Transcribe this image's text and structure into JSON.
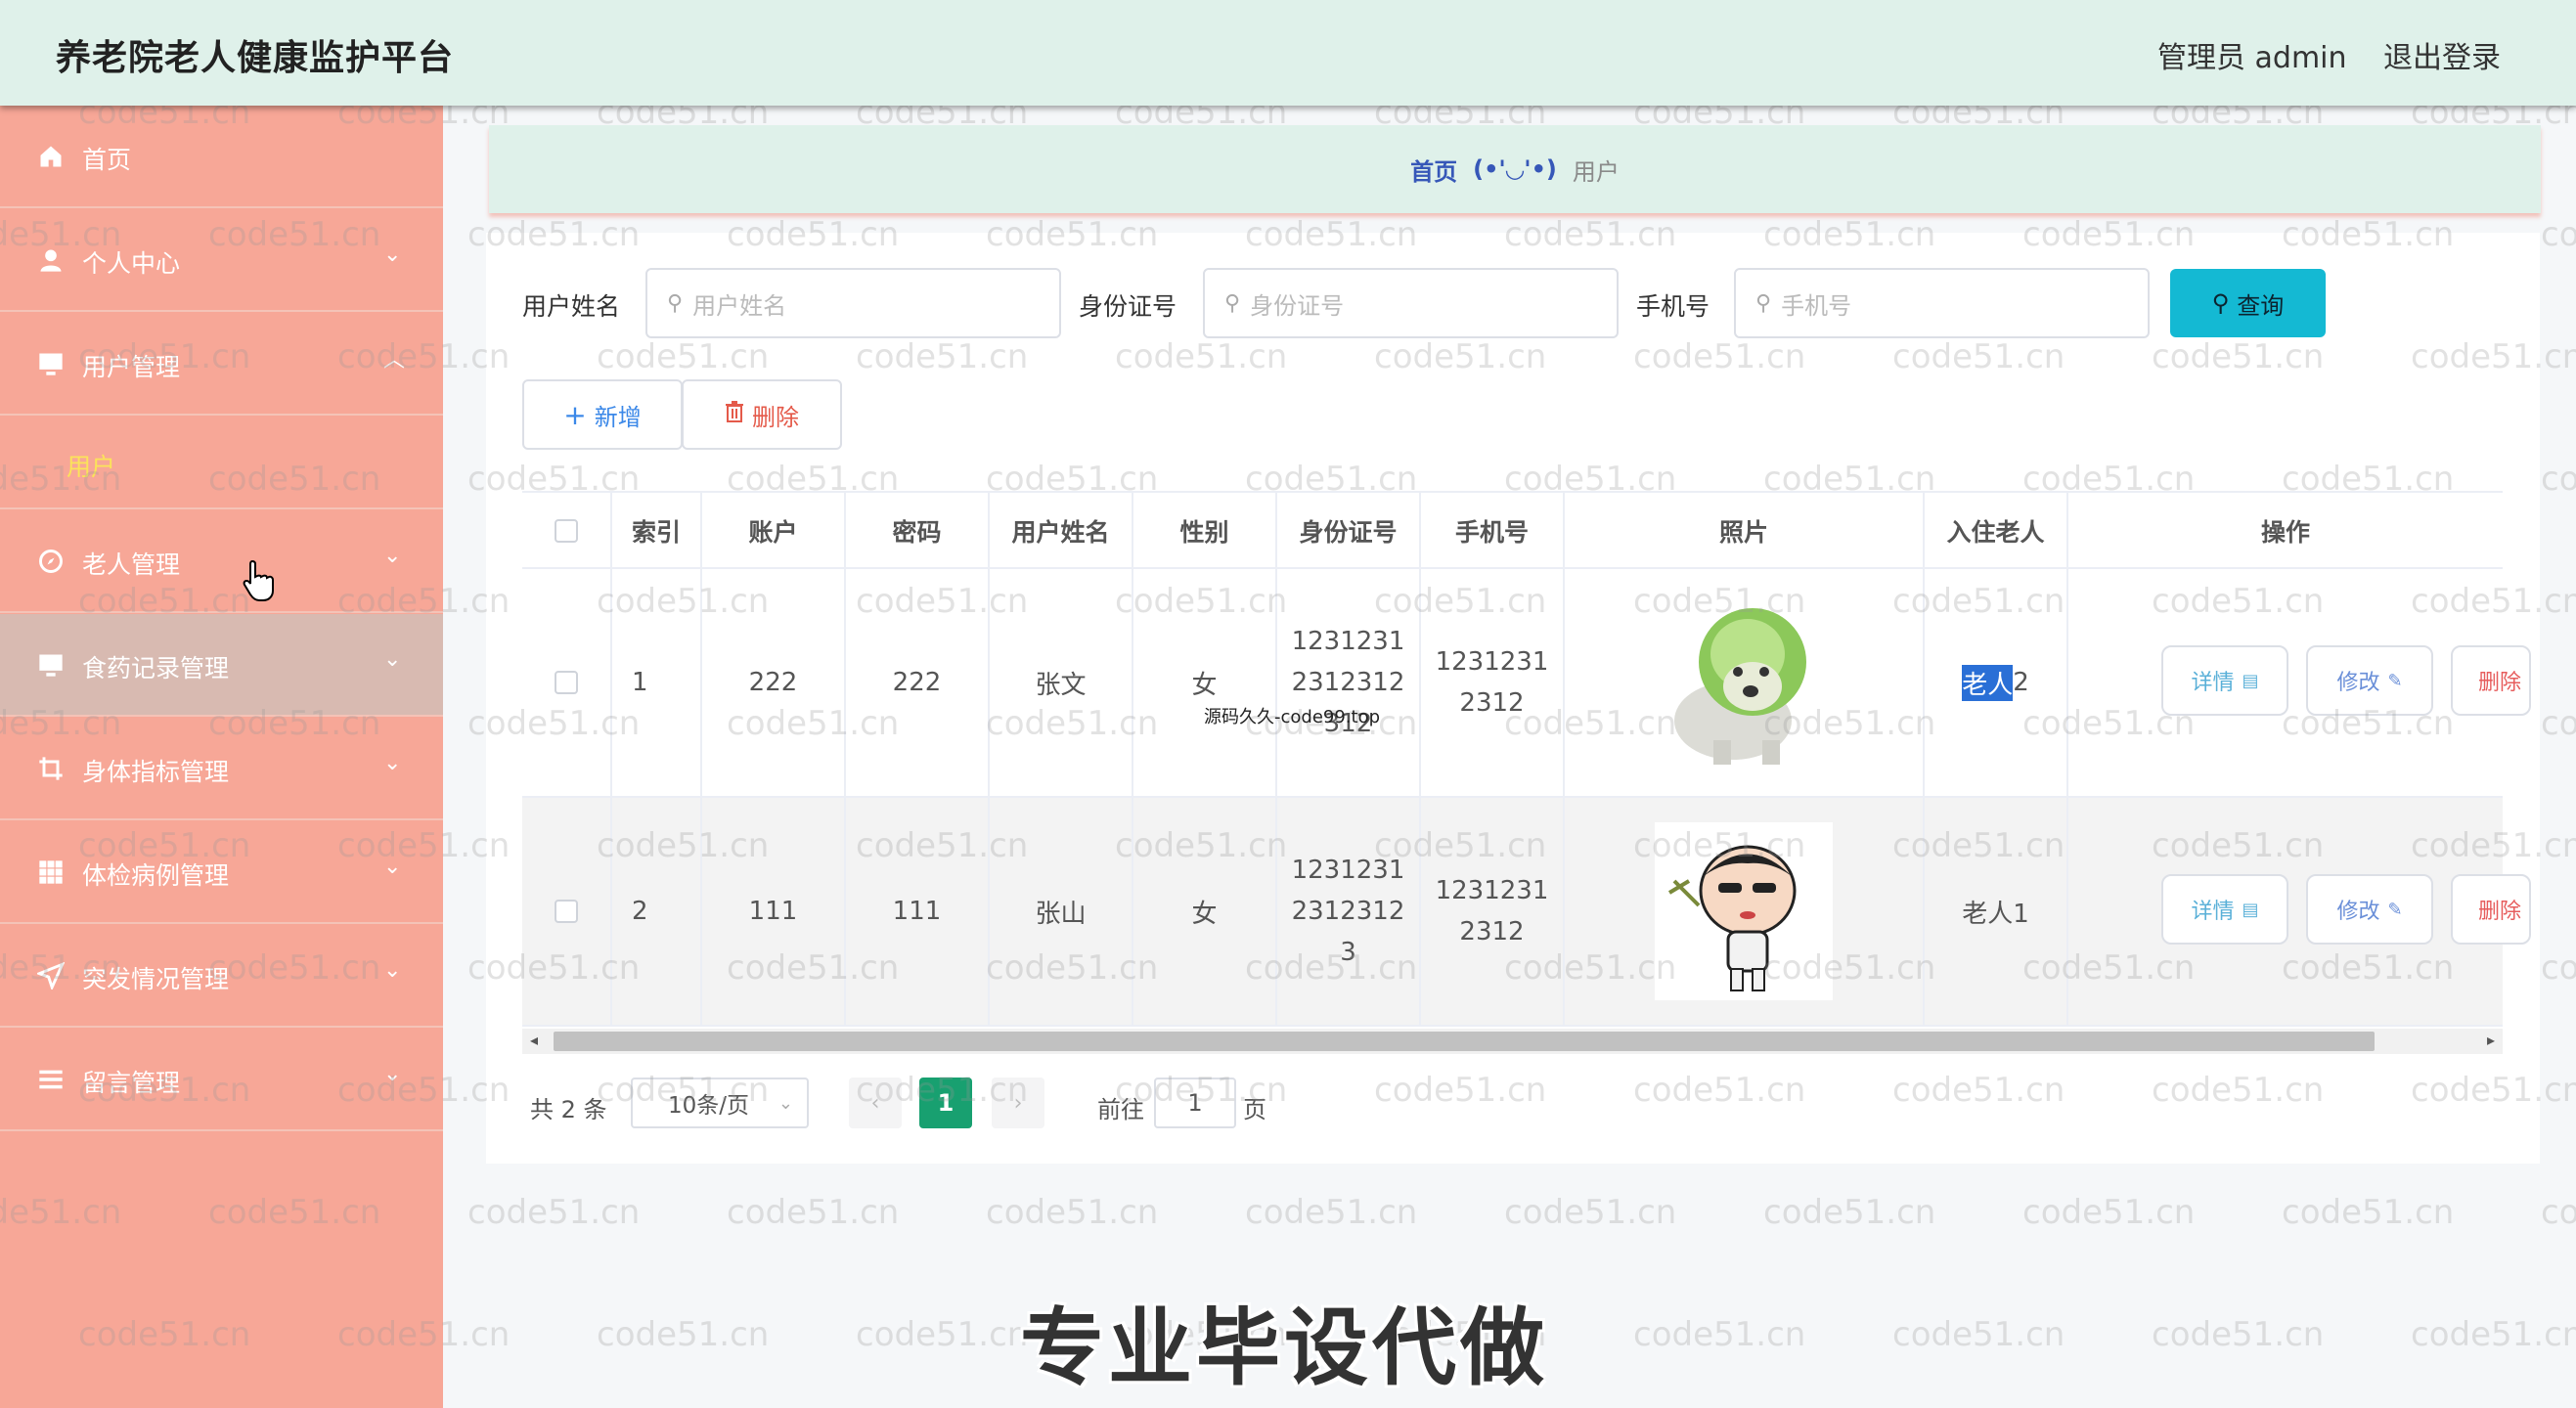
{
  "header": {
    "title": "养老院老人健康监护平台",
    "user": "管理员 admin",
    "logout": "退出登录"
  },
  "sidebar": {
    "items": [
      {
        "label": "首页",
        "icon": "home-icon"
      },
      {
        "label": "个人中心",
        "icon": "user-icon"
      },
      {
        "label": "用户管理",
        "icon": "monitor-icon"
      },
      {
        "label": "用户",
        "sub": true
      },
      {
        "label": "老人管理",
        "icon": "compass-icon"
      },
      {
        "label": "食药记录管理",
        "icon": "monitor-icon"
      },
      {
        "label": "身体指标管理",
        "icon": "crop-icon"
      },
      {
        "label": "体检病例管理",
        "icon": "grid-icon"
      },
      {
        "label": "突发情况管理",
        "icon": "send-icon"
      },
      {
        "label": "留言管理",
        "icon": "list-icon"
      }
    ]
  },
  "breadcrumb": {
    "home": "首页",
    "face": "(•'◡'•)",
    "current": "用户"
  },
  "search": {
    "name_label": "用户姓名",
    "name_placeholder": "用户姓名",
    "id_label": "身份证号",
    "id_placeholder": "身份证号",
    "phone_label": "手机号",
    "phone_placeholder": "手机号",
    "button": "查询"
  },
  "toolbar": {
    "add": "新增",
    "delete": "删除"
  },
  "table": {
    "headers": [
      "索引",
      "账户",
      "密码",
      "用户姓名",
      "性别",
      "身份证号",
      "手机号",
      "照片",
      "入住老人",
      "操作"
    ],
    "rows": [
      {
        "index": "1",
        "account": "222",
        "password": "222",
        "name": "张文",
        "gender": "女",
        "id_card": "1231231\n2312312\n312",
        "phone": "1231231\n2312",
        "elder_hl": "老人",
        "elder_rest": "2",
        "photo": "cabbage-dog-photo"
      },
      {
        "index": "2",
        "account": "111",
        "password": "111",
        "name": "张山",
        "gender": "女",
        "id_card": "1231231\n2312312\n3",
        "phone": "1231231\n2312",
        "elder_hl": "",
        "elder_rest": "老人1",
        "photo": "cartoon-boy-photo"
      }
    ],
    "actions": {
      "detail": "详情",
      "edit": "修改",
      "delete": "删除"
    }
  },
  "pager": {
    "total": "共 2 条",
    "size": "10条/页",
    "current": "1",
    "goto": "前往",
    "page_value": "1",
    "page_unit": "页"
  },
  "overlay": {
    "caption": "专业毕设代做",
    "source_text": "源码久久-code99.top",
    "watermark": "code51.cn"
  },
  "colors": {
    "header_bg": "#dff1ea",
    "sidebar_bg": "#f7a797",
    "primary": "#14b9d3",
    "active_page": "#18a070"
  }
}
